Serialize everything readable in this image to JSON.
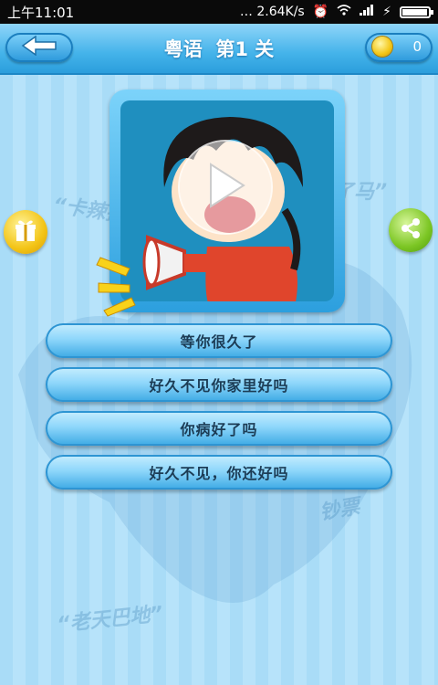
{
  "status_bar": {
    "time": "上午11:01",
    "network_speed": "2.64K/s",
    "battery_percent": 95
  },
  "header": {
    "title": "粤语  第1 关",
    "coins": "0",
    "back_icon": "back-arrow-icon",
    "coin_icon": "coin-icon"
  },
  "background_texts": [
    "“卡辣拉",
    "了马”",
    "“老天巴地”",
    "钞票"
  ],
  "side_buttons": {
    "gift_icon": "gift-icon",
    "share_icon": "share-icon"
  },
  "picture": {
    "play_icon": "play-icon",
    "illustration": "cartoon-boy-with-megaphone"
  },
  "answers": [
    "等你很久了",
    "好久不见你家里好吗",
    "你病好了吗",
    "好久不见，你还好吗"
  ],
  "colors": {
    "header": "#44b3ea",
    "button": "#3ca9e4",
    "gift": "#f3c416",
    "share": "#7cc624"
  }
}
